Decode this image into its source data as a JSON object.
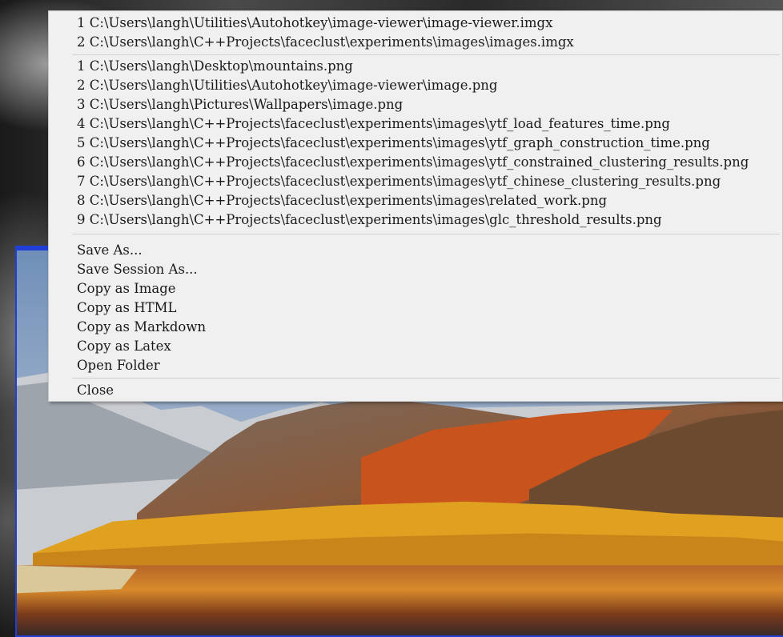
{
  "context_menu": {
    "session_files": [
      "1 C:\\Users\\langh\\Utilities\\Autohotkey\\image-viewer\\image-viewer.imgx",
      "2 C:\\Users\\langh\\C++Projects\\faceclust\\experiments\\images\\images.imgx"
    ],
    "recent_images": [
      "1 C:\\Users\\langh\\Desktop\\mountains.png",
      "2 C:\\Users\\langh\\Utilities\\Autohotkey\\image-viewer\\image.png",
      "3 C:\\Users\\langh\\Pictures\\Wallpapers\\image.png",
      "4 C:\\Users\\langh\\C++Projects\\faceclust\\experiments\\images\\ytf_load_features_time.png",
      "5 C:\\Users\\langh\\C++Projects\\faceclust\\experiments\\images\\ytf_graph_construction_time.png",
      "6 C:\\Users\\langh\\C++Projects\\faceclust\\experiments\\images\\ytf_constrained_clustering_results.png",
      "7 C:\\Users\\langh\\C++Projects\\faceclust\\experiments\\images\\ytf_chinese_clustering_results.png",
      "8 C:\\Users\\langh\\C++Projects\\faceclust\\experiments\\images\\related_work.png",
      "9 C:\\Users\\langh\\C++Projects\\faceclust\\experiments\\images\\glc_threshold_results.png"
    ],
    "actions": {
      "save_as": "Save As...",
      "save_session_as": "Save Session As...",
      "copy_as_image": "Copy as Image",
      "copy_as_html": "Copy as HTML",
      "copy_as_markdown": "Copy as Markdown",
      "copy_as_latex": "Copy as Latex",
      "open_folder": "Open Folder"
    },
    "close": "Close"
  },
  "colors": {
    "window_border": "#1f3fd6",
    "menu_background": "#f0f0f0",
    "menu_text": "#1a1a1a"
  }
}
